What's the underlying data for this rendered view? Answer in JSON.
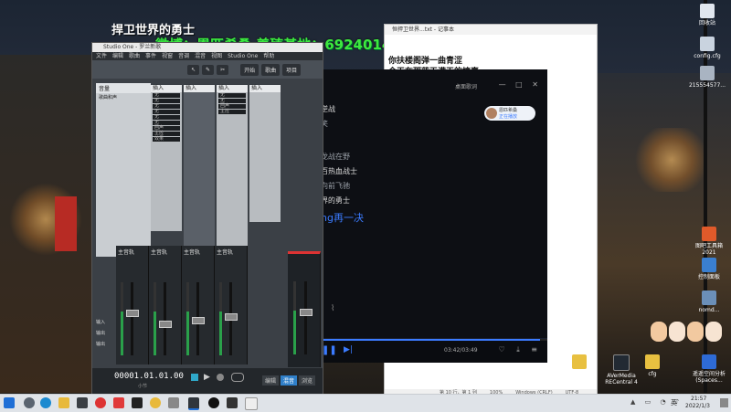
{
  "overlay": {
    "song_title": "捍卫世界的勇士",
    "banner": "微博：恩匹希桑 养殖基地：692401497 B站：臭小子Npc"
  },
  "studio_one": {
    "window_title": "Studio One - 罗兰新歌",
    "menu": [
      "文件",
      "编辑",
      "歌曲",
      "事件",
      "视窗",
      "音调",
      "混音",
      "视图",
      "Studio One",
      "帮助"
    ],
    "tool_buttons": [
      "开始",
      "歌曲",
      "项目"
    ],
    "channel_header": "音量",
    "channel_sub": "歌曲和声",
    "fx_items": [
      "无",
      "无",
      "无",
      "无",
      "无",
      "无",
      "回声",
      "主控",
      "效果"
    ],
    "strip_labels": [
      "主音轨",
      "主音轨",
      "主音轨",
      "主音轨"
    ],
    "bottom_labels": [
      "输入",
      "输出",
      "输出"
    ],
    "counter": "00001.01.01.00",
    "counter_sub": "小节",
    "footer_buttons": [
      "编辑",
      "混音",
      "浏览"
    ],
    "transport_icons": [
      "stop-icon",
      "play-icon",
      "record-icon",
      "loop-icon"
    ]
  },
  "player": {
    "top_right_label": "桌面歌词",
    "lyrics": [
      "逆战",
      "笑",
      "龙战在野",
      "百热血战士",
      "向前飞驰",
      "界的勇士",
      "ng再一决"
    ],
    "active_lyric": "ng再一决",
    "user_chip": {
      "name": "恩匹希桑",
      "sub": "正在播放"
    },
    "time": "03:42/03:49",
    "accent": "#3b7bff"
  },
  "notepad": {
    "title": "恒捍卫世界...txt - 记事本",
    "lines": [
      "你扶楼阁弹一曲青涩",
      "今天在那蓝天满天的惊喜"
    ],
    "status": [
      "第 10 行，第 1 列",
      "100%",
      "Windows (CRLF)",
      "UTF-8"
    ]
  },
  "desktop_icons": [
    {
      "label": "回收站",
      "color": "#e0e6ee"
    },
    {
      "label": "config.cfg",
      "color": "#c9d3df"
    },
    {
      "label": "215554577...",
      "color": "#a9b4c2"
    },
    {
      "label": "图吧工具箱 2021",
      "color": "#e05a2a"
    },
    {
      "label": "控制面板",
      "color": "#3a7fd0"
    },
    {
      "label": "nomd...",
      "color": "#6b8fb8"
    },
    {
      "label": "遥遥空间分析 (Spaces...",
      "color": "#2e6bd6"
    },
    {
      "label": "cfg",
      "color": "#e8c040"
    },
    {
      "label": "AVerMedia RECentral 4",
      "color": "#222a33"
    },
    {
      "label": "cfg",
      "color": "#e8c040"
    }
  ],
  "taskbar": {
    "time": "21:57",
    "date": "2022/1/3",
    "lang": "英"
  }
}
